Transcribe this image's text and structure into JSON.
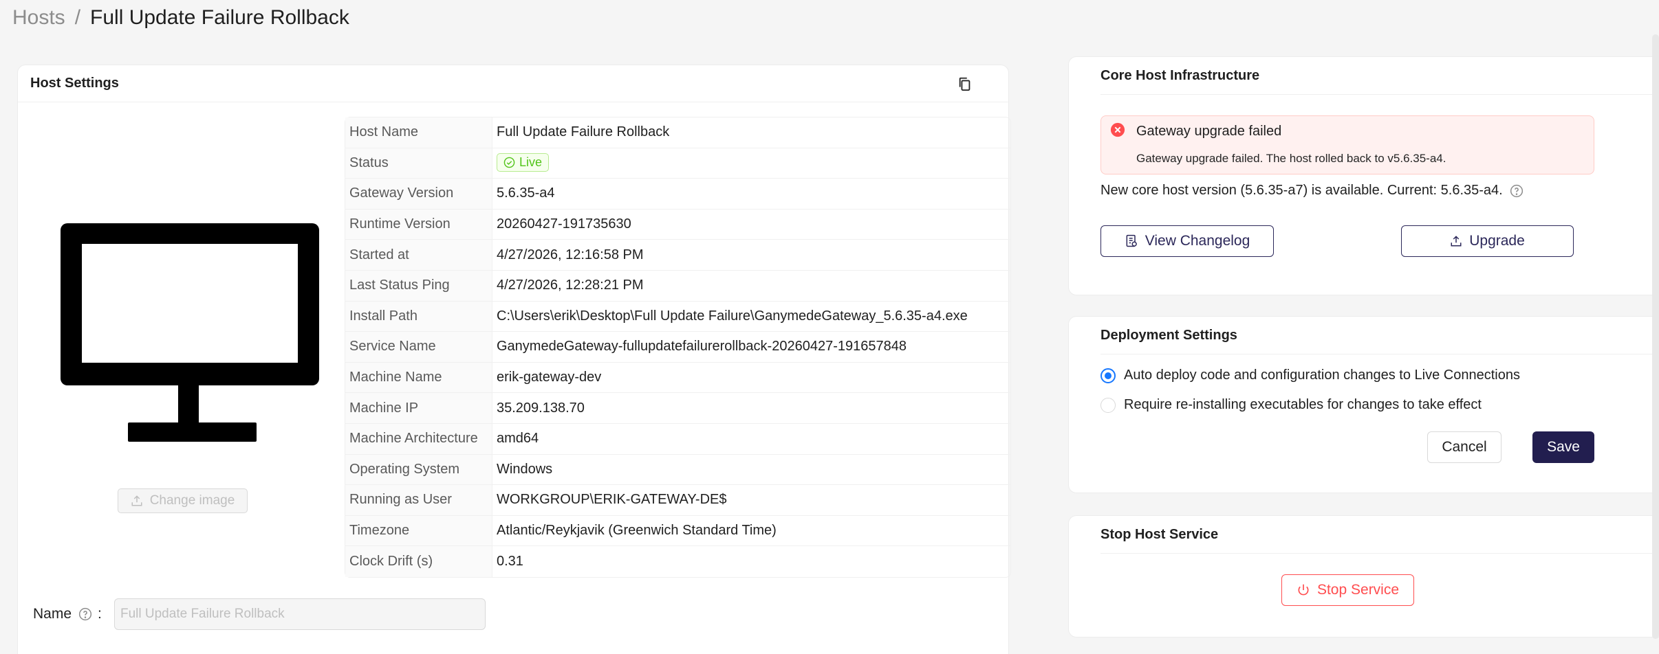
{
  "breadcrumb": {
    "parent": "Hosts",
    "separator": "/",
    "current": "Full Update Failure Rollback"
  },
  "host_settings": {
    "title": "Host Settings",
    "change_image_label": "Change image",
    "rows": [
      {
        "key": "Host Name",
        "value": "Full Update Failure Rollback"
      },
      {
        "key": "Status",
        "value": "Live"
      },
      {
        "key": "Gateway Version",
        "value": "5.6.35-a4"
      },
      {
        "key": "Runtime Version",
        "value": "20260427-191735630"
      },
      {
        "key": "Started at",
        "value": "4/27/2026, 12:16:58 PM"
      },
      {
        "key": "Last Status Ping",
        "value": "4/27/2026, 12:28:21 PM"
      },
      {
        "key": "Install Path",
        "value": "C:\\Users\\erik\\Desktop\\Full Update Failure\\GanymedeGateway_5.6.35-a4.exe"
      },
      {
        "key": "Service Name",
        "value": "GanymedeGateway-fullupdatefailurerollback-20260427-191657848"
      },
      {
        "key": "Machine Name",
        "value": "erik-gateway-dev"
      },
      {
        "key": "Machine IP",
        "value": "35.209.138.70"
      },
      {
        "key": "Machine Architecture",
        "value": "amd64"
      },
      {
        "key": "Operating System",
        "value": "Windows"
      },
      {
        "key": "Running as User",
        "value": "WORKGROUP\\ERIK-GATEWAY-DE$"
      },
      {
        "key": "Timezone",
        "value": "Atlantic/Reykjavik (Greenwich Standard Time)"
      },
      {
        "key": "Clock Drift (s)",
        "value": "0.31"
      }
    ],
    "name_label": "Name",
    "name_colon": ":",
    "name_value": "Full Update Failure Rollback"
  },
  "core": {
    "title": "Core Host Infrastructure",
    "alert_title": "Gateway upgrade failed",
    "alert_desc": "Gateway upgrade failed. The host rolled back to v5.6.35-a4.",
    "version_text": "New core host version (5.6.35-a7) is available. Current: 5.6.35-a4.",
    "changelog_label": "View Changelog",
    "upgrade_label": "Upgrade"
  },
  "deployment": {
    "title": "Deployment Settings",
    "option_auto": "Auto deploy code and configuration changes to Live Connections",
    "option_reinstall": "Require re-installing executables for changes to take effect",
    "selected": "auto",
    "cancel_label": "Cancel",
    "save_label": "Save"
  },
  "stop": {
    "title": "Stop Host Service",
    "button_label": "Stop Service"
  },
  "colors": {
    "primary": "#221e4f",
    "success": "#52c41a",
    "danger": "#ff4d4f",
    "radio": "#1677ff"
  }
}
